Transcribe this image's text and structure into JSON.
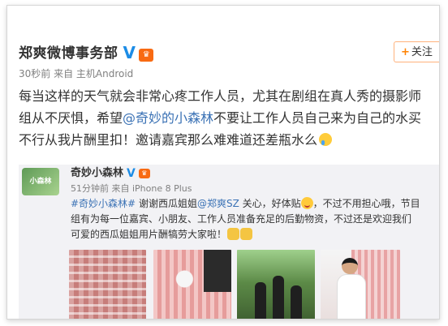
{
  "post": {
    "author": "郑爽微博事务部",
    "verified_mark": "V",
    "follow_button": "关注",
    "meta": "30秒前 来自 主机Android",
    "text_lines": [
      "每当这样的天气就会非常心疼工作人员，尤其在剧组在真人秀的摄影师",
      "组从不厌惧，希望",
      "@奇妙的小森林",
      "不要让工作人员自己来为自己的水买",
      "不行从我片酬里扣！邀请嘉宾那么难难道还差瓶水么"
    ]
  },
  "comment": {
    "author": "奇妙小森林",
    "verified_mark": "V",
    "avatar_text": "小森林",
    "meta": "51分钟前 来自 iPhone 8 Plus",
    "tag": "#奇妙小森林#",
    "text_1": " 谢谢西瓜姐姐",
    "mention": "@郑爽SZ",
    "text_2": " 关心，好体贴",
    "text_3": "，不过不用担心哦，节目",
    "line_2": "组有为每一位嘉宾、小朋友、工作人员准备充足的后勤物资，不过还是欢迎我们",
    "line_3": "可爱的西瓜姐姐用片酬犒劳大家啦！"
  },
  "icons": {
    "verified": "verified-icon",
    "vip": "vip-badge-icon",
    "cry_emoji": "cry-emoji-icon",
    "smile_emoji": "smile-emoji-icon",
    "clap_emoji": "clap-emoji-icon"
  },
  "colors": {
    "link": "#3b72b5",
    "verified": "#1c8ce6",
    "follow_accent": "#ff8200"
  }
}
